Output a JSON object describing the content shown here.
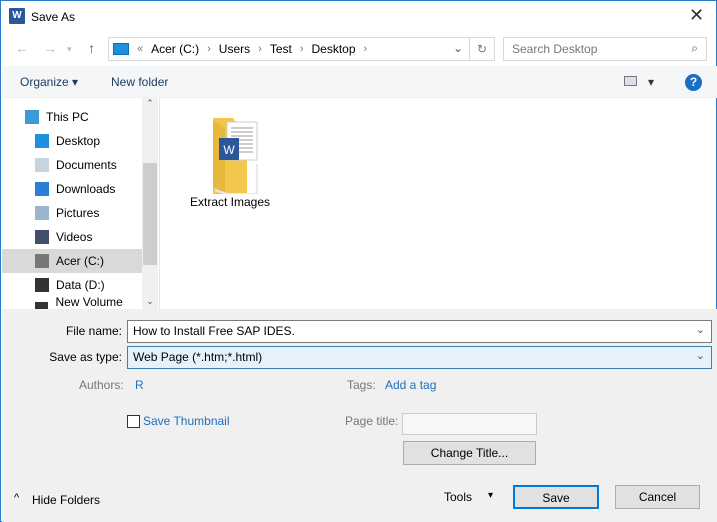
{
  "window": {
    "title": "Save As",
    "app_icon": "word-icon",
    "close": "✕"
  },
  "address": {
    "root_icon": "this-pc-icon",
    "overflow": "«",
    "crumbs": [
      "Acer (C:)",
      "Users",
      "Test",
      "Desktop"
    ],
    "separator": "›",
    "dropdown": "⌄",
    "refresh": "↻"
  },
  "search": {
    "placeholder": "Search Desktop",
    "icon": "⌕"
  },
  "toolbar": {
    "organize": "Organize ▾",
    "new_folder": "New folder",
    "view": "▾",
    "help": "?"
  },
  "nav": {
    "items": [
      {
        "label": "This PC",
        "icon": "this-pc-icon",
        "color": "#3a9ad9"
      },
      {
        "label": "Desktop",
        "icon": "desktop-icon",
        "color": "#1e90e0"
      },
      {
        "label": "Documents",
        "icon": "documents-icon",
        "color": "#c8d4e0"
      },
      {
        "label": "Downloads",
        "icon": "downloads-icon",
        "color": "#2a7fd4"
      },
      {
        "label": "Pictures",
        "icon": "pictures-icon",
        "color": "#9db5cc"
      },
      {
        "label": "Videos",
        "icon": "videos-icon",
        "color": "#40506a"
      },
      {
        "label": "Acer (C:)",
        "icon": "drive-icon",
        "color": "#777777",
        "selected": true
      },
      {
        "label": "Data (D:)",
        "icon": "drive-icon",
        "color": "#333333"
      },
      {
        "label": "New Volume (E:)",
        "icon": "drive-icon",
        "color": "#333333"
      }
    ]
  },
  "files": [
    {
      "name": "Extract Images",
      "icon": "folder-word-icon"
    }
  ],
  "form": {
    "file_name_label": "File name:",
    "file_name": "How to Install Free SAP IDES.",
    "type_label": "Save as type:",
    "type": "Web Page (*.htm;*.html)",
    "authors_label": "Authors:",
    "authors": "R",
    "tags_label": "Tags:",
    "tags": "Add a tag",
    "thumbnail_label": "Save Thumbnail",
    "thumbnail_checked": false,
    "page_title_label": "Page title:",
    "page_title": "",
    "change_title": "Change Title..."
  },
  "footer": {
    "hide_folders": "Hide Folders",
    "hide_icon": "^",
    "tools": "Tools",
    "tools_arrow": "▾",
    "save": "Save",
    "cancel": "Cancel"
  }
}
